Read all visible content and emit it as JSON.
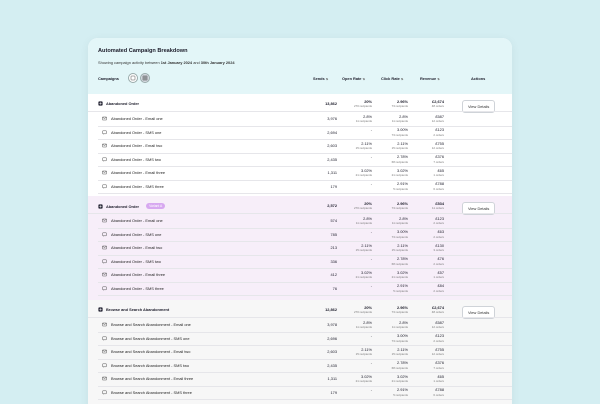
{
  "header": {
    "title": "Automated Campaign Breakdown",
    "subtitle_prefix": "Showing campaign activity between",
    "date_start": "1st January 2024",
    "subtitle_mid": "and",
    "date_end": "30th January 2024"
  },
  "columns": {
    "campaigns": "Campaigns",
    "sends": "Sends",
    "open_rate": "Open Rate",
    "click_rate": "Click Rate",
    "revenue": "Revenue",
    "actions": "Actions"
  },
  "view_details_label": "View Details",
  "groups": [
    {
      "name": "Abandoned Order",
      "badge": "",
      "sends": "13,862",
      "open": "20%",
      "open_sub": "270 recipients",
      "click": "2.96%",
      "click_sub": "73 recipients",
      "rev": "£2,674",
      "rev_sub": "48 orders",
      "children": [
        {
          "name": "Abandoned Order - Email one",
          "type": "email",
          "sends": "3,976",
          "open": "2.8%",
          "open_sub": "11 recipients",
          "click": "2.8%",
          "click_sub": "11 recipients",
          "rev": "£587",
          "rev_sub": "12 orders"
        },
        {
          "name": "Abandoned Order - SMS one",
          "type": "sms",
          "sends": "2,694",
          "open": "-",
          "open_sub": "",
          "click": "3.00%",
          "click_sub": "73 recipients",
          "rev": "£123",
          "rev_sub": "2 orders"
        },
        {
          "name": "Abandoned Order - Email two",
          "type": "email",
          "sends": "2,603",
          "open": "2.11%",
          "open_sub": "15 recipients",
          "click": "2.11%",
          "click_sub": "15 recipients",
          "rev": "£755",
          "rev_sub": "12 orders"
        },
        {
          "name": "Abandoned Order - SMS two",
          "type": "sms",
          "sends": "2,435",
          "open": "-",
          "open_sub": "",
          "click": "2.78%",
          "click_sub": "68 recipients",
          "rev": "£376",
          "rev_sub": "7 orders"
        },
        {
          "name": "Abandoned Order - Email three",
          "type": "email",
          "sends": "1,311",
          "open": "3.02%",
          "open_sub": "21 recipients",
          "click": "3.02%",
          "click_sub": "21 recipients",
          "rev": "£65",
          "rev_sub": "1 orders"
        },
        {
          "name": "Abandoned Order - SMS three",
          "type": "sms",
          "sends": "179",
          "open": "-",
          "open_sub": "",
          "click": "2.91%",
          "click_sub": "5 recipients",
          "rev": "£788",
          "rev_sub": "6 orders"
        }
      ]
    },
    {
      "name": "Abandoned Order",
      "badge": "Variant A",
      "sends": "2,572",
      "open": "20%",
      "open_sub": "270 recipients",
      "click": "2.96%",
      "click_sub": "73 recipients",
      "rev": "£534",
      "rev_sub": "11 orders",
      "children": [
        {
          "name": "Abandoned Order - Email one",
          "type": "email",
          "sends": "574",
          "open": "2.8%",
          "open_sub": "11 recipients",
          "click": "2.8%",
          "click_sub": "11 recipients",
          "rev": "£123",
          "rev_sub": "2 orders"
        },
        {
          "name": "Abandoned Order - SMS one",
          "type": "sms",
          "sends": "785",
          "open": "-",
          "open_sub": "",
          "click": "3.00%",
          "click_sub": "73 recipients",
          "rev": "£63",
          "rev_sub": "2 orders"
        },
        {
          "name": "Abandoned Order - Email two",
          "type": "email",
          "sends": "213",
          "open": "2.11%",
          "open_sub": "15 recipients",
          "click": "2.11%",
          "click_sub": "15 recipients",
          "rev": "£130",
          "rev_sub": "3 orders"
        },
        {
          "name": "Abandoned Order - SMS two",
          "type": "sms",
          "sends": "336",
          "open": "-",
          "open_sub": "",
          "click": "2.78%",
          "click_sub": "68 recipients",
          "rev": "£76",
          "rev_sub": "2 orders"
        },
        {
          "name": "Abandoned Order - Email three",
          "type": "email",
          "sends": "412",
          "open": "3.02%",
          "open_sub": "21 recipients",
          "click": "3.02%",
          "click_sub": "21 recipients",
          "rev": "£57",
          "rev_sub": "1 orders"
        },
        {
          "name": "Abandoned Order - SMS three",
          "type": "sms",
          "sends": "76",
          "open": "-",
          "open_sub": "",
          "click": "2.91%",
          "click_sub": "5 recipients",
          "rev": "£84",
          "rev_sub": "2 orders"
        }
      ]
    },
    {
      "name": "Browse and Search Abandonment",
      "badge": "",
      "sends": "12,862",
      "open": "20%",
      "open_sub": "270 recipients",
      "click": "2.96%",
      "click_sub": "73 recipients",
      "rev": "£2,674",
      "rev_sub": "48 orders",
      "children": [
        {
          "name": "Browse and Search Abandonment - Email one",
          "type": "email",
          "sends": "3,978",
          "open": "2.8%",
          "open_sub": "11 recipients",
          "click": "2.8%",
          "click_sub": "11 recipients",
          "rev": "£587",
          "rev_sub": "12 orders"
        },
        {
          "name": "Browse and Search Abandonment - SMS one",
          "type": "sms",
          "sends": "2,696",
          "open": "-",
          "open_sub": "",
          "click": "3.00%",
          "click_sub": "73 recipients",
          "rev": "£123",
          "rev_sub": "2 orders"
        },
        {
          "name": "Browse and Search Abandonment - Email two",
          "type": "email",
          "sends": "2,603",
          "open": "2.11%",
          "open_sub": "15 recipients",
          "click": "2.11%",
          "click_sub": "15 recipients",
          "rev": "£755",
          "rev_sub": "12 orders"
        },
        {
          "name": "Browse and Search Abandonment - SMS two",
          "type": "sms",
          "sends": "2,435",
          "open": "-",
          "open_sub": "",
          "click": "2.78%",
          "click_sub": "68 recipients",
          "rev": "£376",
          "rev_sub": "7 orders"
        },
        {
          "name": "Browse and Search Abandonment - Email three",
          "type": "email",
          "sends": "1,311",
          "open": "3.02%",
          "open_sub": "21 recipients",
          "click": "3.02%",
          "click_sub": "21 recipients",
          "rev": "£65",
          "rev_sub": "1 orders"
        },
        {
          "name": "Browse and Search Abandonment - SMS three",
          "type": "sms",
          "sends": "179",
          "open": "-",
          "open_sub": "",
          "click": "2.91%",
          "click_sub": "5 recipients",
          "rev": "£788",
          "rev_sub": "6 orders"
        }
      ]
    }
  ]
}
